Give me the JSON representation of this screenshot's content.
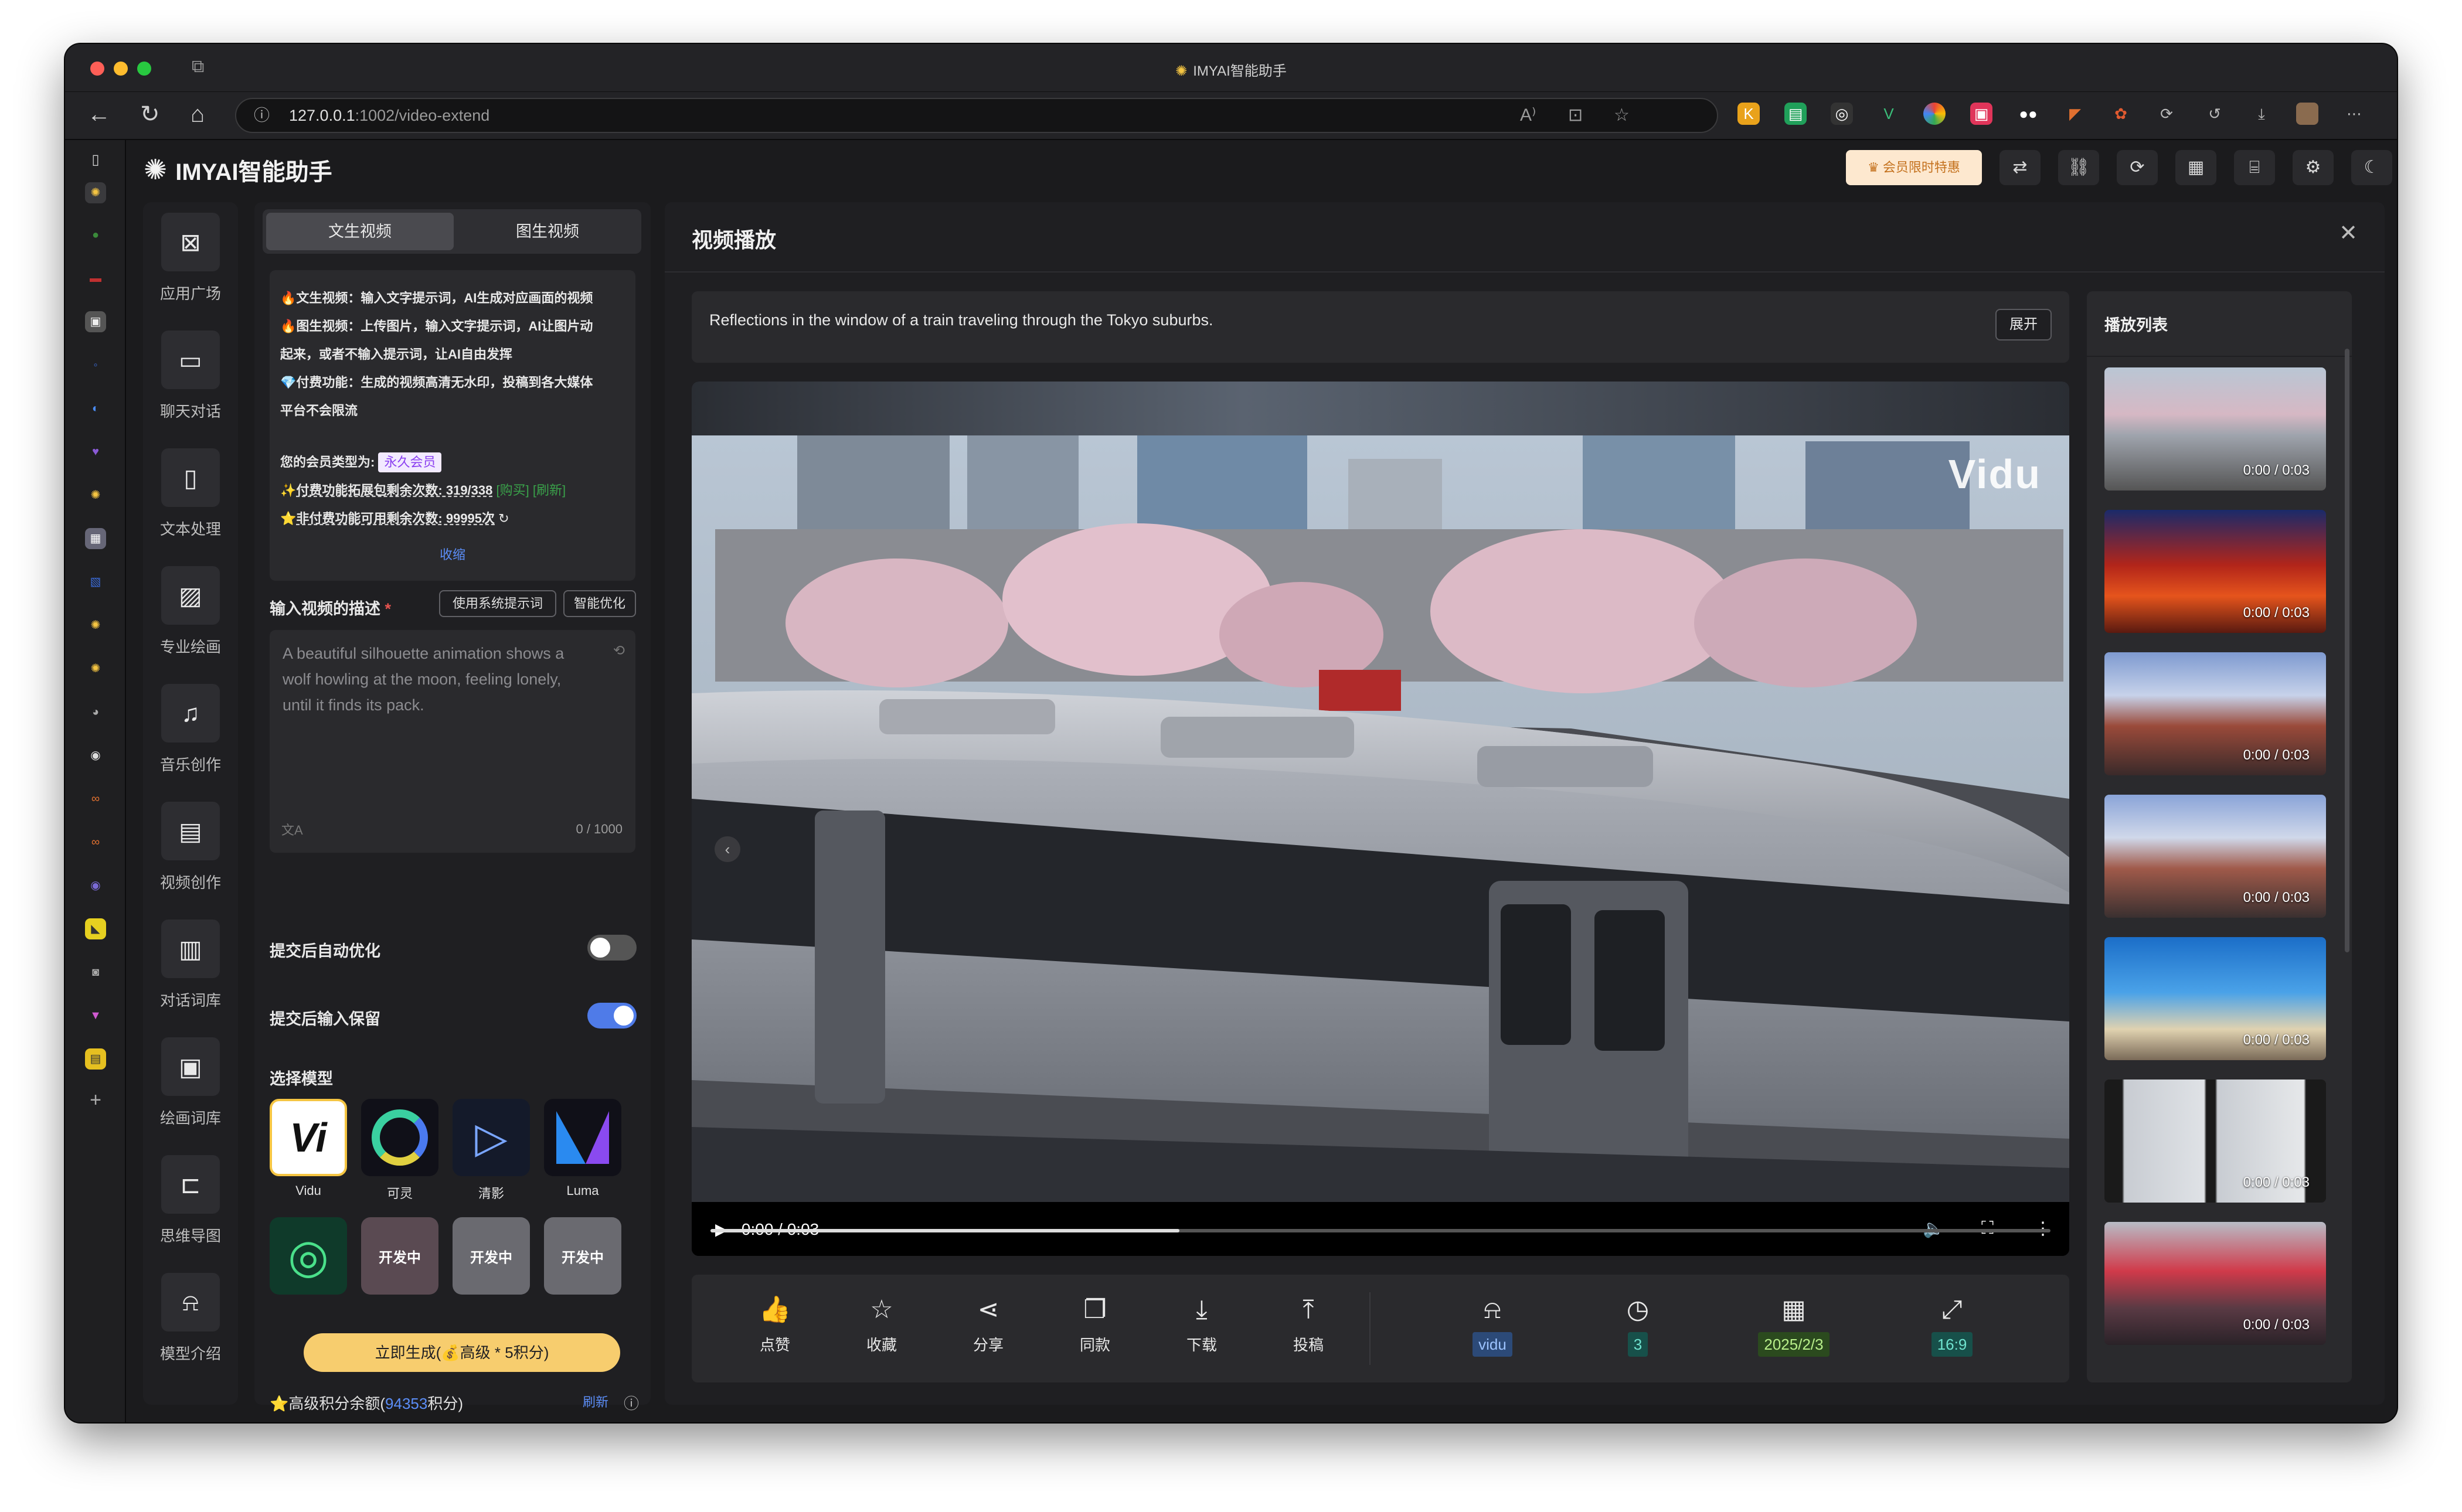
{
  "browser": {
    "window_title": "IMYAI智能助手",
    "url_host": "127.0.0.1",
    "url_rest": ":1002/video-extend",
    "traffic_colors": [
      "#fe5f57",
      "#febc2e",
      "#28c840"
    ]
  },
  "app": {
    "brand": "IMYAI智能助手",
    "vip_button": "会员限时特惠"
  },
  "sidenav": [
    {
      "label": "应用广场",
      "icon": "app-store-icon"
    },
    {
      "label": "聊天对话",
      "icon": "chat-icon"
    },
    {
      "label": "文本处理",
      "icon": "text-doc-icon"
    },
    {
      "label": "专业绘画",
      "icon": "image-icon"
    },
    {
      "label": "音乐创作",
      "icon": "music-icon"
    },
    {
      "label": "视频创作",
      "icon": "video-icon"
    },
    {
      "label": "对话词库",
      "icon": "dialog-library-icon"
    },
    {
      "label": "绘画词库",
      "icon": "paint-library-icon"
    },
    {
      "label": "思维导图",
      "icon": "mindmap-icon"
    },
    {
      "label": "模型介绍",
      "icon": "robot-icon"
    }
  ],
  "left_panel": {
    "tabs": [
      "文生视频",
      "图生视频"
    ],
    "info_lines": [
      "🔥文生视频：输入文字提示词，AI生成对应画面的视频",
      "🔥图生视频：上传图片，输入文字提示词，AI让图片动",
      "起来，或者不输入提示词，让AI自由发挥",
      "💎付费功能：生成的视频高清无水印，投稿到各大媒体",
      "平台不会限流"
    ],
    "member_label": "您的会员类型为:",
    "member_type": "永久会员",
    "paid_remaining": "付费功能拓展包剩余次数: 319/338",
    "buy": "[购买]",
    "refresh_bracket": "[刷新]",
    "free_remaining": "非付费功能可用剩余次数: 99995次",
    "collapse": "收缩",
    "desc_label": "输入视频的描述",
    "required_mark": "*",
    "btn_system_prompt": "使用系统提示词",
    "btn_smart_optimize": "智能优化",
    "textarea_placeholder": "A beautiful silhouette animation shows a wolf howling at the moon, feeling lonely, until it finds its pack.",
    "char_count": "0 / 1000",
    "auto_optimize_label": "提交后自动优化",
    "auto_optimize_on": false,
    "keep_input_label": "提交后输入保留",
    "keep_input_on": true,
    "model_label": "选择模型",
    "models": [
      {
        "name": "Vidu",
        "icon": "vidu-logo-icon",
        "status": ""
      },
      {
        "name": "可灵",
        "icon": "kling-logo-icon",
        "status": ""
      },
      {
        "name": "清影",
        "icon": "qingying-logo-icon",
        "status": ""
      },
      {
        "name": "Luma",
        "icon": "luma-logo-icon",
        "status": ""
      },
      {
        "name": "",
        "icon": "hailuo-logo-icon",
        "status": ""
      },
      {
        "name": "",
        "icon": "pika-logo-icon",
        "status": "开发中"
      },
      {
        "name": "",
        "icon": "runway-logo-icon",
        "status": "开发中"
      },
      {
        "name": "",
        "icon": "sora-logo-icon",
        "status": "开发中"
      }
    ],
    "generate_button": "立即生成(💰高级 * 5积分)",
    "balance_prefix": "高级积分余额(",
    "balance_value": "94353",
    "balance_suffix": "积分)",
    "balance_refresh": "刷新"
  },
  "main": {
    "title": "视频播放",
    "prompt_text": "Reflections in the window of a train traveling through the Tokyo suburbs.",
    "expand_button": "展开",
    "watermark": "Vidu",
    "time": "0:00 / 0:03",
    "progress": 0.35,
    "actions": [
      "点赞",
      "收藏",
      "分享",
      "同款",
      "下载",
      "投稿"
    ],
    "meta": [
      {
        "icon": "robot-icon",
        "value": "vidu",
        "color": "#2c4a78",
        "text_color": "#9cc3ff"
      },
      {
        "icon": "clock-icon",
        "value": "3",
        "color": "#17504a",
        "text_color": "#6fe3cf"
      },
      {
        "icon": "calendar-icon",
        "value": "2025/2/3",
        "color": "#2b4a1e",
        "text_color": "#b8f08a"
      },
      {
        "icon": "aspect-ratio-icon",
        "value": "16:9",
        "color": "#17504a",
        "text_color": "#6fe3cf"
      }
    ]
  },
  "playlist": {
    "title": "播放列表",
    "items": [
      {
        "time": "0:00 / 0:03",
        "theme": "sakura-train"
      },
      {
        "time": "0:00 / 0:03",
        "theme": "red-festival"
      },
      {
        "time": "0:00 / 0:03",
        "theme": "snow-market"
      },
      {
        "time": "0:00 / 0:03",
        "theme": "snowy-street"
      },
      {
        "time": "0:00 / 0:03",
        "theme": "motorbike-beach"
      },
      {
        "time": "0:00 / 0:03",
        "theme": "train-window"
      },
      {
        "time": "0:00 / 0:03",
        "theme": "tokyo-street"
      }
    ]
  }
}
